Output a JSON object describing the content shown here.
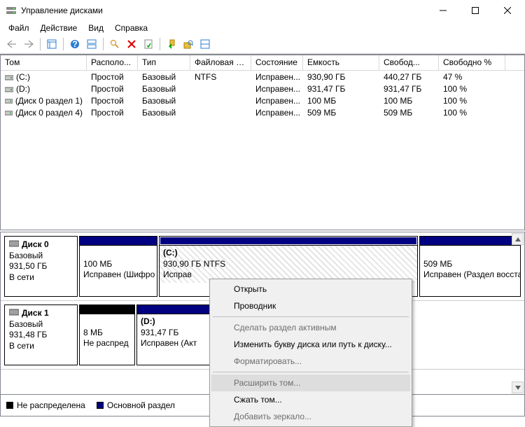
{
  "window": {
    "title": "Управление дисками"
  },
  "menu": {
    "file": "Файл",
    "action": "Действие",
    "view": "Вид",
    "help": "Справка"
  },
  "columns": {
    "c0": "Том",
    "c1": "Располо...",
    "c2": "Тип",
    "c3": "Файловая с...",
    "c4": "Состояние",
    "c5": "Емкость",
    "c6": "Свобод...",
    "c7": "Свободно %"
  },
  "volumes": [
    {
      "name": "(C:)",
      "layout": "Простой",
      "type": "Базовый",
      "fs": "NTFS",
      "status": "Исправен...",
      "capacity": "930,90 ГБ",
      "free": "440,27 ГБ",
      "pct": "47 %"
    },
    {
      "name": "(D:)",
      "layout": "Простой",
      "type": "Базовый",
      "fs": "",
      "status": "Исправен...",
      "capacity": "931,47 ГБ",
      "free": "931,47 ГБ",
      "pct": "100 %"
    },
    {
      "name": "(Диск 0 раздел 1)",
      "layout": "Простой",
      "type": "Базовый",
      "fs": "",
      "status": "Исправен...",
      "capacity": "100 МБ",
      "free": "100 МБ",
      "pct": "100 %"
    },
    {
      "name": "(Диск 0 раздел 4)",
      "layout": "Простой",
      "type": "Базовый",
      "fs": "",
      "status": "Исправен...",
      "capacity": "509 МБ",
      "free": "509 МБ",
      "pct": "100 %"
    }
  ],
  "disks": {
    "d0": {
      "name": "Диск 0",
      "type": "Базовый",
      "size": "931,50 ГБ",
      "status": "В сети",
      "p1_size": "100 МБ",
      "p1_status": "Исправен (Шифро",
      "p2_name": "(C:)",
      "p2_size": "930,90 ГБ NTFS",
      "p2_status": "Исправ",
      "p3_size": "509 МБ",
      "p3_status": "Исправен (Раздел восстан"
    },
    "d1": {
      "name": "Диск 1",
      "type": "Базовый",
      "size": "931,48 ГБ",
      "status": "В сети",
      "p1_size": "8 МБ",
      "p1_status": "Не распред",
      "p2_name": "(D:)",
      "p2_size": "931,47 ГБ",
      "p2_status": "Исправен (Акт"
    }
  },
  "legend": {
    "unalloc": "Не распределена",
    "primary": "Основной раздел"
  },
  "context": {
    "open": "Открыть",
    "explorer": "Проводник",
    "active": "Сделать раздел активным",
    "letter": "Изменить букву диска или путь к диску...",
    "format": "Форматировать...",
    "extend": "Расширить том...",
    "shrink": "Сжать том...",
    "mirror": "Добавить зеркало..."
  }
}
